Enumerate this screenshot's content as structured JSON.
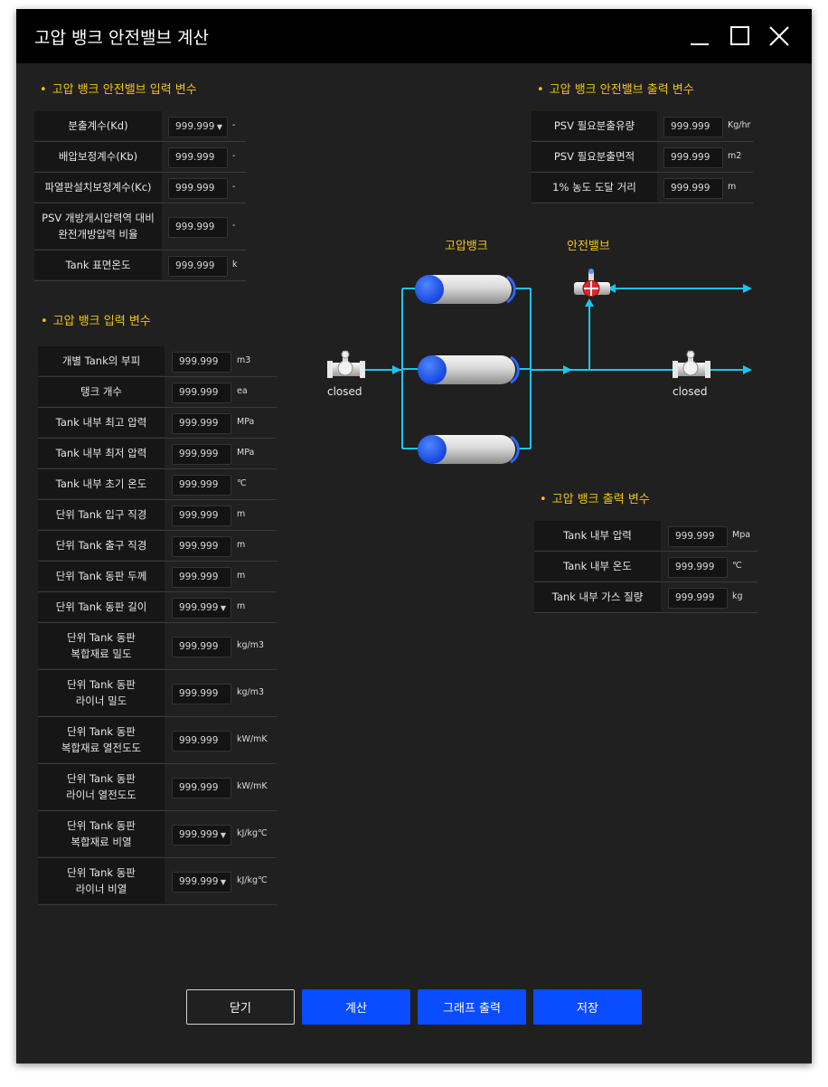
{
  "window": {
    "title": "고압 뱅크 안전밸브 계산"
  },
  "psv_input": {
    "title": "고압 뱅크 안전밸브 입력 변수",
    "rows": [
      {
        "label": "분출계수(Kd)",
        "value": "999.999",
        "unit": "-",
        "dropdown": true
      },
      {
        "label": "배압보정계수(Kb)",
        "value": "999.999",
        "unit": "-"
      },
      {
        "label": "파열판설치보정계수(Kc)",
        "value": "999.999",
        "unit": "-"
      },
      {
        "label": "PSV 개방개시압력역 대비\n완전개방압력 비율",
        "value": "999.999",
        "unit": "-"
      },
      {
        "label": "Tank 표면온도",
        "value": "999.999",
        "unit": "k"
      }
    ]
  },
  "psv_output": {
    "title": "고압 뱅크 안전밸브 출력 변수",
    "rows": [
      {
        "label": "PSV 필요분출유량",
        "value": "999.999",
        "unit": "Kg/hr"
      },
      {
        "label": "PSV 필요분출면적",
        "value": "999.999",
        "unit": "m2"
      },
      {
        "label": "1% 농도 도달 거리",
        "value": "999.999",
        "unit": "m"
      }
    ]
  },
  "bank_input": {
    "title": "고압 뱅크 입력 변수",
    "rows": [
      {
        "label": "개별 Tank의 부피",
        "value": "999.999",
        "unit": "m3"
      },
      {
        "label": "탱크 개수",
        "value": "999.999",
        "unit": "ea"
      },
      {
        "label": "Tank 내부 최고 압력",
        "value": "999.999",
        "unit": "MPa"
      },
      {
        "label": "Tank 내부 최저 압력",
        "value": "999.999",
        "unit": "MPa"
      },
      {
        "label": "Tank 내부 초기 온도",
        "value": "999.999",
        "unit": "℃"
      },
      {
        "label": "단위 Tank 입구 직경",
        "value": "999.999",
        "unit": "m"
      },
      {
        "label": "단위 Tank 출구 직경",
        "value": "999.999",
        "unit": "m"
      },
      {
        "label": "단위 Tank 동판 두께",
        "value": "999.999",
        "unit": "m"
      },
      {
        "label": "단위 Tank 동판 길이",
        "value": "999.999",
        "unit": "m",
        "dropdown": true
      },
      {
        "label": "단위 Tank 동판\n복합재료 밀도",
        "value": "999.999",
        "unit": "kg/m3"
      },
      {
        "label": "단위 Tank 동판\n라이너 밀도",
        "value": "999.999",
        "unit": "kg/m3"
      },
      {
        "label": "단위 Tank 동판\n복합재료 열전도도",
        "value": "999.999",
        "unit": "kW/mK"
      },
      {
        "label": "단위 Tank 동판\n라이너 열전도도",
        "value": "999.999",
        "unit": "kW/mK"
      },
      {
        "label": "단위 Tank 동판\n복합재료 비열",
        "value": "999.999",
        "unit": "kJ/kg℃",
        "dropdown": true
      },
      {
        "label": "단위 Tank 동판\n라이너 비열",
        "value": "999.999",
        "unit": "kJ/kg℃",
        "dropdown": true
      }
    ]
  },
  "bank_output": {
    "title": "고압 뱅크 출력 변수",
    "rows": [
      {
        "label": "Tank 내부 압력",
        "value": "999.999",
        "unit": "Mpa"
      },
      {
        "label": "Tank 내부 온도",
        "value": "999.999",
        "unit": "℃"
      },
      {
        "label": "Tank 내부 가스 질량",
        "value": "999.999",
        "unit": "kg"
      }
    ]
  },
  "diagram": {
    "bank_label": "고압뱅크",
    "valve_label": "안전밸브",
    "inlet_valve_status": "closed",
    "outlet_valve_status": "closed",
    "colors": {
      "pipe": "#19c6f0",
      "tank_cap": "#1a55ff",
      "relief_valve": "#e0262c"
    }
  },
  "buttons": {
    "close": "닫기",
    "calculate": "계산",
    "graph": "그래프 출력",
    "save": "저장"
  },
  "colors": {
    "accent": "#f0c419",
    "primary_button": "#0a4cff",
    "title_bar": "#000000",
    "panel": "#202020"
  },
  "icons": {
    "minimize": "minimize-icon",
    "maximize": "maximize-icon",
    "close": "close-icon"
  }
}
